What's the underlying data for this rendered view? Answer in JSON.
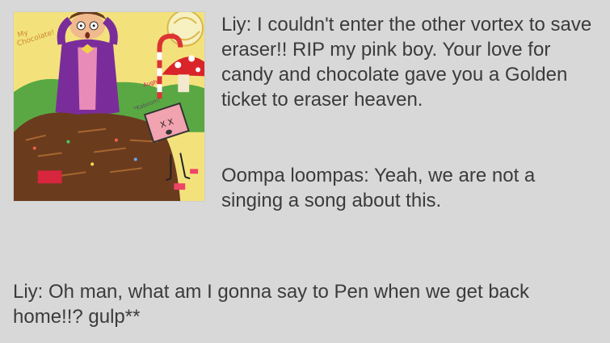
{
  "post": {
    "image": {
      "caption_top": "My\nChocolate!",
      "sound_label": "Augh!",
      "sound_label_2": "*Kaboom!",
      "eraser_eyes": "X X"
    },
    "paragraph_1": "Liy: I couldn't enter the other vortex to save\neraser!! RIP my pink boy. Your love for\ncandy and chocolate gave you a Golden\nticket to eraser heaven.",
    "paragraph_2": "Oompa loompas: Yeah, we are not a\nsinging a song about this.",
    "paragraph_3": "Liy: Oh man, what am I gonna say to Pen when we get back\nhome!!? gulp**"
  },
  "colors": {
    "background": "#d8d8d8",
    "text": "#3b3b3b"
  }
}
